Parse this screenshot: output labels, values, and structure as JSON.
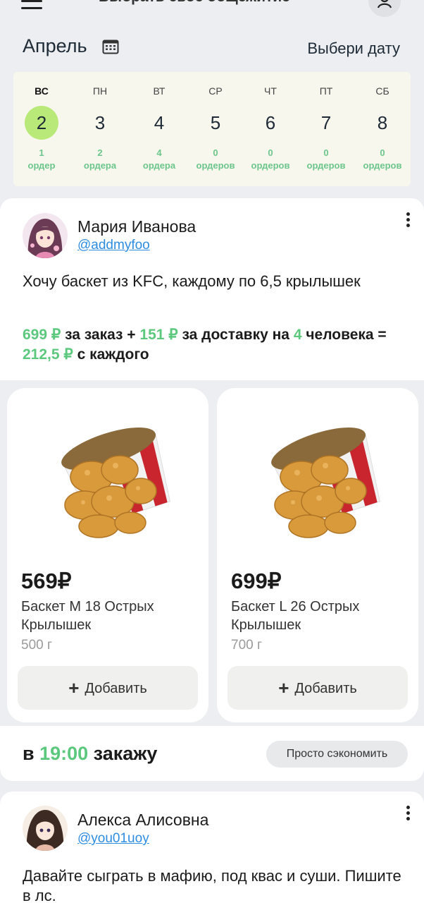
{
  "header": {
    "dorm_title": "Выбрать своё общежитие",
    "chevron": "›",
    "month": "Апрель",
    "pick_date": "Выбери дату"
  },
  "week": {
    "days": [
      {
        "name": "ВС",
        "num": "2",
        "count": "1",
        "unit": "ордер",
        "active": true
      },
      {
        "name": "ПН",
        "num": "3",
        "count": "2",
        "unit": "ордера"
      },
      {
        "name": "ВТ",
        "num": "4",
        "count": "4",
        "unit": "ордера"
      },
      {
        "name": "СР",
        "num": "5",
        "count": "0",
        "unit": "ордеров"
      },
      {
        "name": "ЧТ",
        "num": "6",
        "count": "0",
        "unit": "ордеров"
      },
      {
        "name": "ПТ",
        "num": "7",
        "count": "0",
        "unit": "ордеров"
      },
      {
        "name": "СБ",
        "num": "8",
        "count": "0",
        "unit": "ордеров"
      }
    ]
  },
  "post1": {
    "author": "Мария Иванова",
    "handle": "@addmyfoo",
    "text": "Хочу баскет из KFC, каждому по 6,5 крылышек",
    "calc": {
      "order_price": "699 ₽",
      "t1": " за заказ + ",
      "delivery_price": "151 ₽",
      "t2": " за доставку на ",
      "people": "4",
      "t3": " человека = ",
      "per_person": "212,5 ₽",
      "t4": " с каждого"
    },
    "products": [
      {
        "price": "569₽",
        "name": "Баскет M 18 Острых Крылышек",
        "weight": "500 г",
        "add": "Добавить"
      },
      {
        "price": "699₽",
        "name": "Баскет L 26 Острых Крылышек",
        "weight": "700 г",
        "add": "Добавить"
      }
    ],
    "order": {
      "prefix": "в ",
      "time": "19:00",
      "suffix": " закажу"
    },
    "chip": "Просто сэкономить"
  },
  "post2": {
    "author": "Алекса Алисовна",
    "handle": "@you01uoy",
    "text": "Давайте сыграть в мафию, под квас и суши. Пишите в лс."
  },
  "colors": {
    "accent_green": "#5cc87e",
    "active_day": "#b9e978",
    "link": "#2e8de0"
  }
}
